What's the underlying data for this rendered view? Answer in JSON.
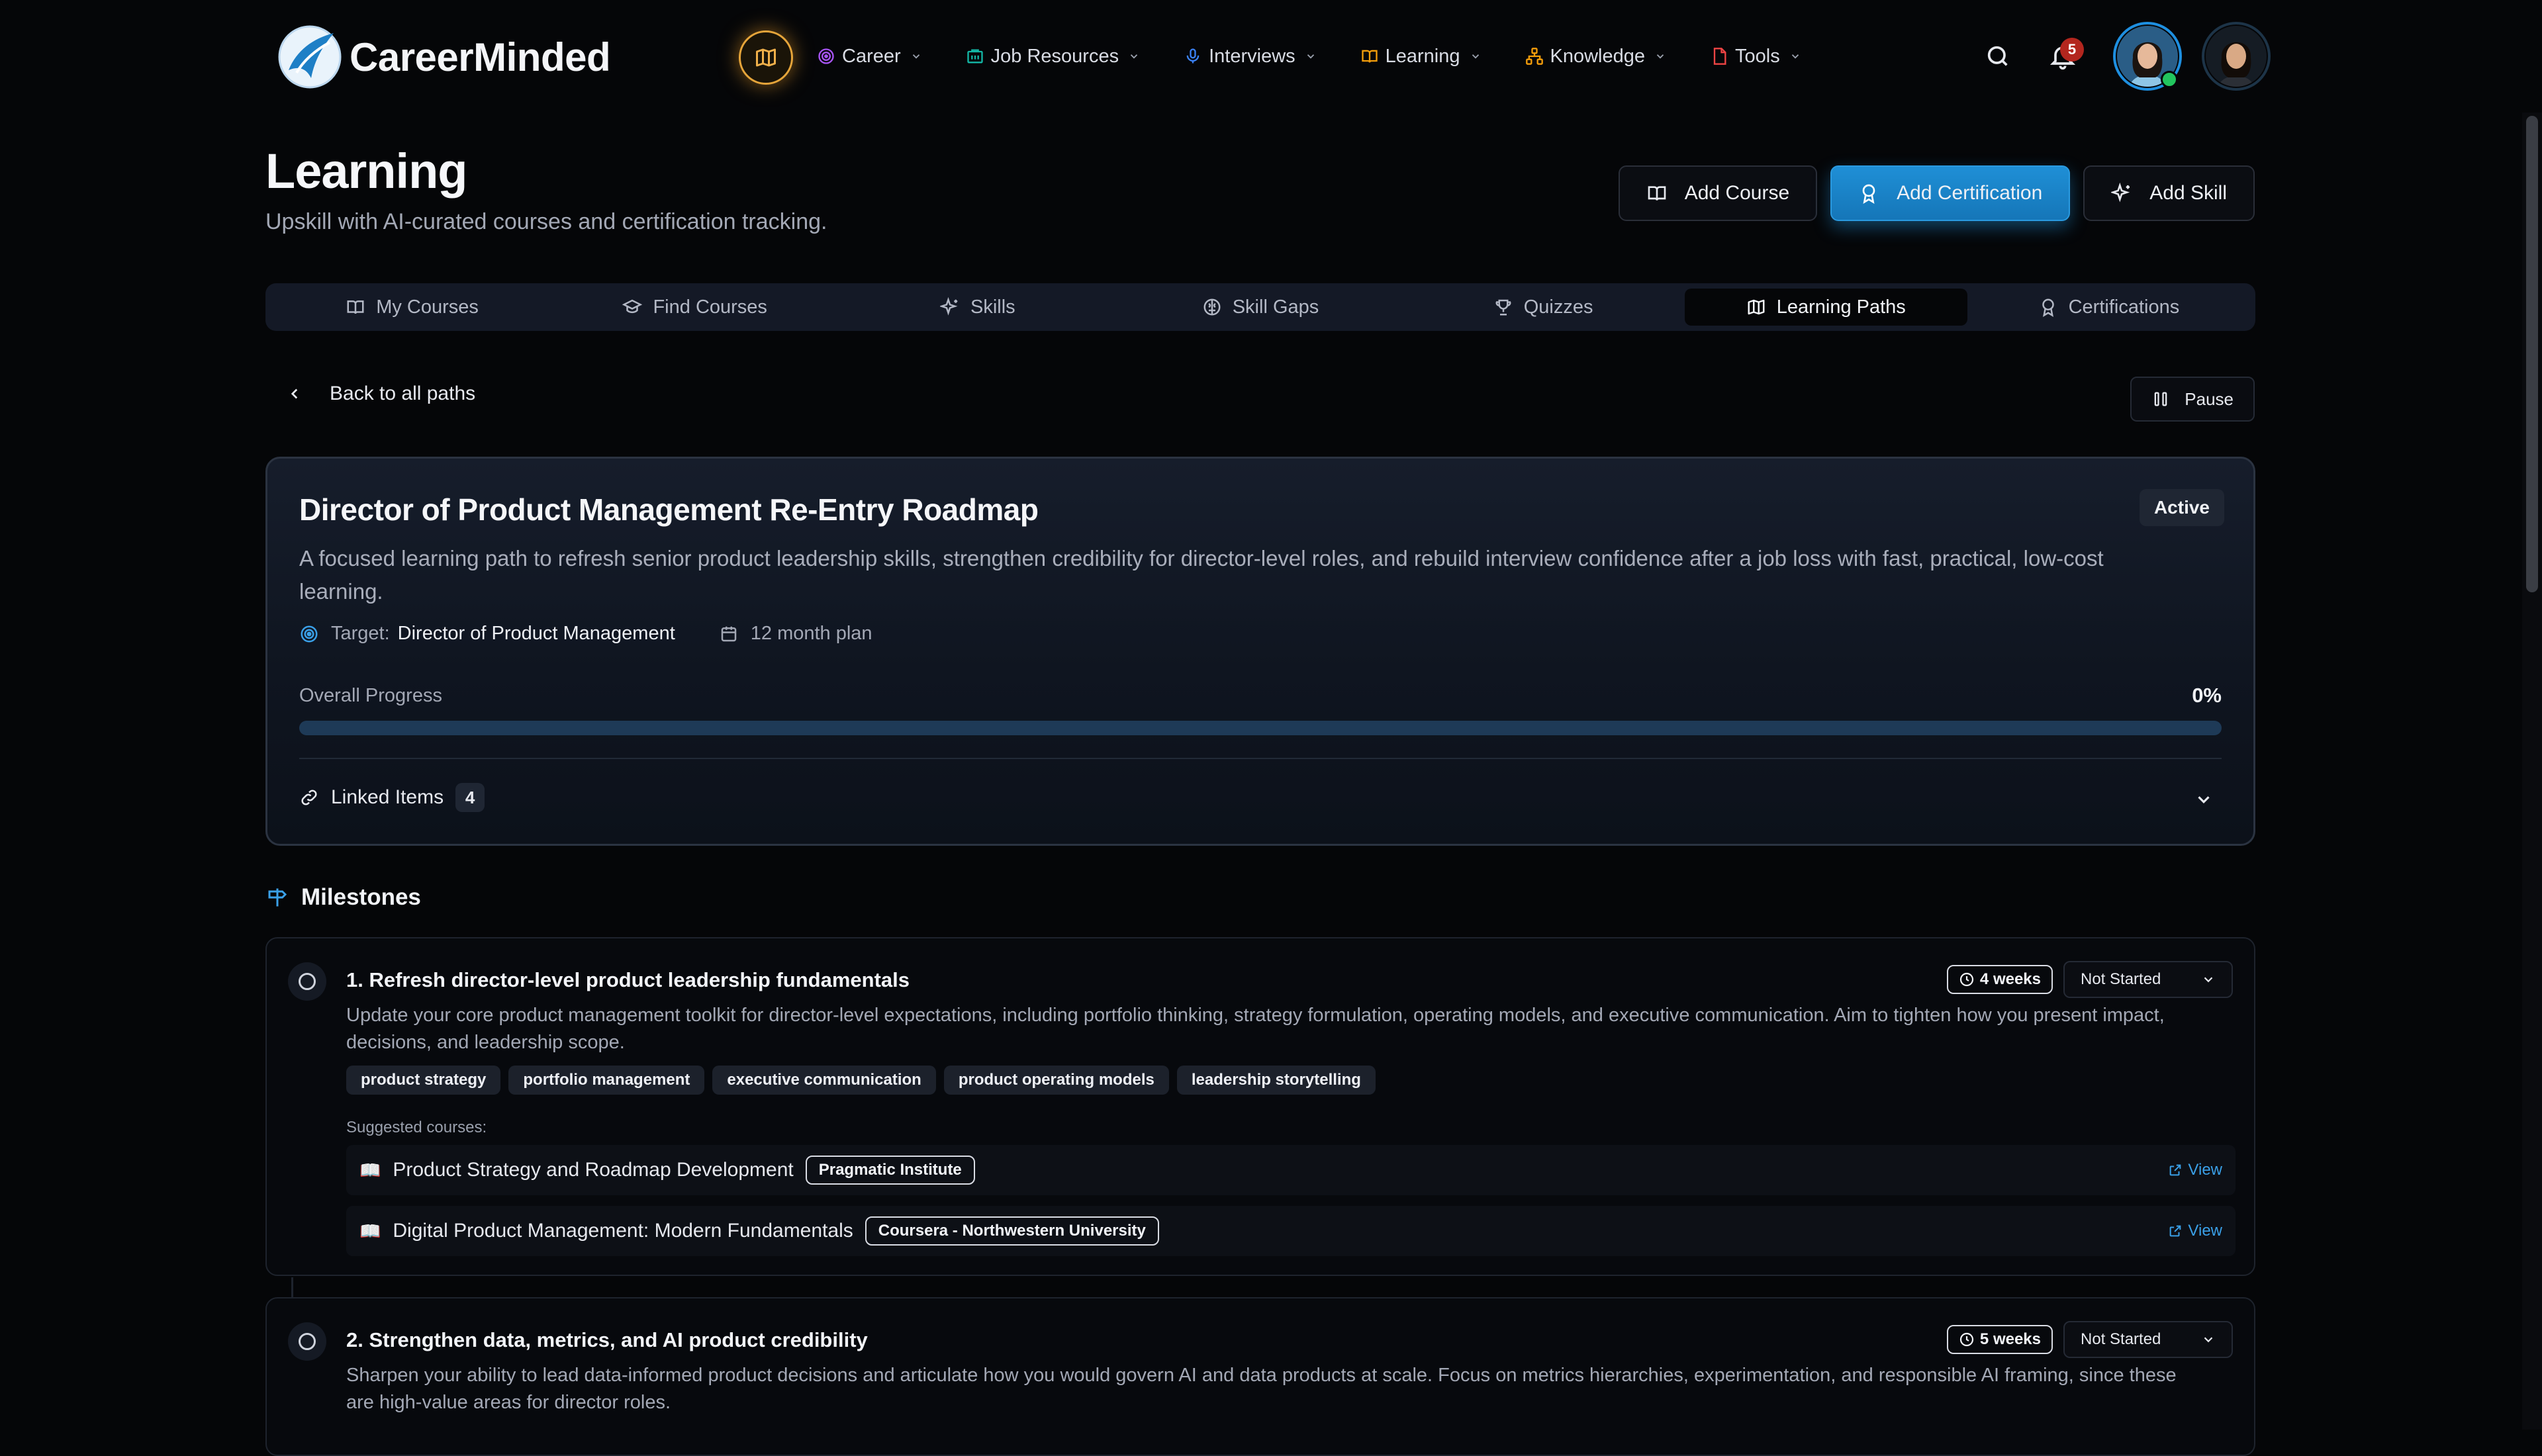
{
  "brand": {
    "name": "CareerMinded"
  },
  "nav": {
    "items": [
      {
        "label": "Career",
        "icon": "target-icon",
        "color": "#a855f7"
      },
      {
        "label": "Job Resources",
        "icon": "building-icon",
        "color": "#14b8a6"
      },
      {
        "label": "Interviews",
        "icon": "microphone-icon",
        "color": "#3b82f6"
      },
      {
        "label": "Learning",
        "icon": "book-icon",
        "color": "#f59e0b"
      },
      {
        "label": "Knowledge",
        "icon": "network-icon",
        "color": "#f59e0b"
      },
      {
        "label": "Tools",
        "icon": "document-icon",
        "color": "#ef4444"
      }
    ],
    "notifications_count": "5"
  },
  "header": {
    "title": "Learning",
    "subtitle": "Upskill with AI-curated courses and certification tracking.",
    "buttons": {
      "add_course": "Add Course",
      "add_certification": "Add Certification",
      "add_skill": "Add Skill"
    }
  },
  "tabs": [
    {
      "label": "My Courses",
      "active": false
    },
    {
      "label": "Find Courses",
      "active": false
    },
    {
      "label": "Skills",
      "active": false
    },
    {
      "label": "Skill Gaps",
      "active": false
    },
    {
      "label": "Quizzes",
      "active": false
    },
    {
      "label": "Learning Paths",
      "active": true
    },
    {
      "label": "Certifications",
      "active": false
    }
  ],
  "back_label": "Back to all paths",
  "pause_label": "Pause",
  "path": {
    "title": "Director of Product Management Re-Entry Roadmap",
    "status": "Active",
    "description": "A focused learning path to refresh senior product leadership skills, strengthen credibility for director-level roles, and rebuild interview confidence after a job loss with fast, practical, low-cost learning.",
    "target_label": "Target:",
    "target_value": "Director of Product Management",
    "plan": "12 month plan",
    "progress_label": "Overall Progress",
    "progress_text": "0%",
    "progress_fraction": 0,
    "linked_label": "Linked Items",
    "linked_count": "4"
  },
  "milestones": {
    "heading": "Milestones",
    "items": [
      {
        "title": "1. Refresh director-level product leadership fundamentals",
        "weeks": "4 weeks",
        "status": "Not Started",
        "description": "Update your core product management toolkit for director-level expectations, including portfolio thinking, strategy formulation, operating models, and executive communication. Aim to tighten how you present impact, decisions, and leadership scope.",
        "tags": [
          "product strategy",
          "portfolio management",
          "executive communication",
          "product operating models",
          "leadership storytelling"
        ],
        "suggested_label": "Suggested courses:",
        "courses": [
          {
            "name": "Product Strategy and Roadmap Development",
            "provider": "Pragmatic Institute",
            "link": "View"
          },
          {
            "name": "Digital Product Management: Modern Fundamentals",
            "provider": "Coursera - Northwestern University",
            "link": "View"
          }
        ]
      },
      {
        "title": "2. Strengthen data, metrics, and AI product credibility",
        "weeks": "5 weeks",
        "status": "Not Started",
        "description": "Sharpen your ability to lead data-informed product decisions and articulate how you would govern AI and data products at scale. Focus on metrics hierarchies, experimentation, and responsible AI framing, since these are high-value areas for director roles."
      }
    ]
  },
  "colors": {
    "accent": "#3aa0e8",
    "primary_button": "#1f8fd6",
    "map_ring": "#e6a53a",
    "background": "#050608"
  }
}
